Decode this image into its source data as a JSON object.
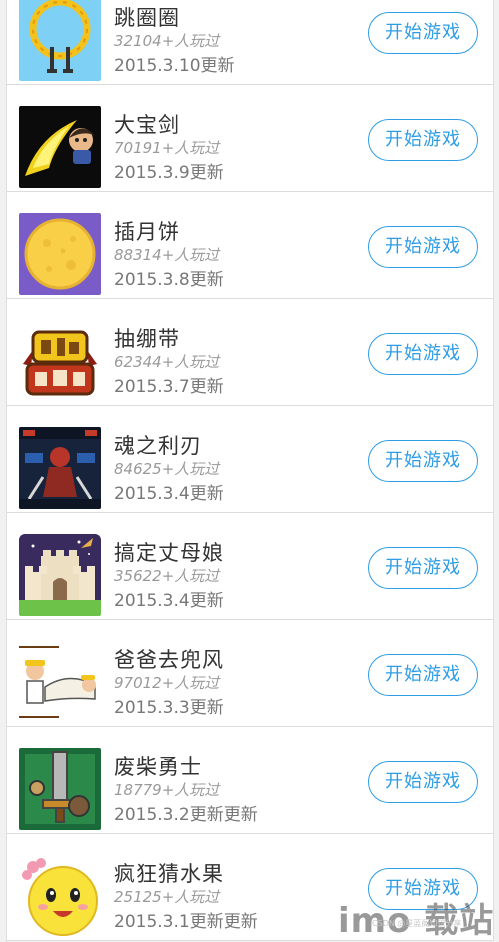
{
  "games": [
    {
      "title": "跳圈圈",
      "players": "32104+人玩过",
      "updated": "2015.3.10更新",
      "button": "开始游戏",
      "icon": "ring-jump-game-icon"
    },
    {
      "title": "大宝剑",
      "players": "70191+人玩过",
      "updated": "2015.3.9更新",
      "button": "开始游戏",
      "icon": "flaming-sword-game-icon"
    },
    {
      "title": "插月饼",
      "players": "88314+人玩过",
      "updated": "2015.3.8更新",
      "button": "开始游戏",
      "icon": "mooncake-game-icon"
    },
    {
      "title": "抽绷带",
      "players": "62344+人玩过",
      "updated": "2015.3.7更新",
      "button": "开始游戏",
      "icon": "monster-fight-logo-icon"
    },
    {
      "title": "魂之利刃",
      "players": "84625+人玩过",
      "updated": "2015.3.4更新",
      "button": "开始游戏",
      "icon": "soul-blade-game-icon"
    },
    {
      "title": "搞定丈母娘",
      "players": "35622+人玩过",
      "updated": "2015.3.4更新",
      "button": "开始游戏",
      "icon": "castle-game-icon"
    },
    {
      "title": "爸爸去兜风",
      "players": "97012+人玩过",
      "updated": "2015.3.3更新",
      "button": "开始游戏",
      "icon": "dad-ride-game-icon"
    },
    {
      "title": "废柴勇士",
      "players": "18779+人玩过",
      "updated": "2015.3.2更新更新",
      "button": "开始游戏",
      "icon": "knight-sword-game-icon"
    },
    {
      "title": "疯狂猜水果",
      "players": "25125+人玩过",
      "updated": "2015.3.1更新更新",
      "button": "开始游戏",
      "icon": "smiley-fruit-game-icon"
    }
  ],
  "watermark": {
    "small": "CSDN @星蓝阁知识分享",
    "big": "imo 载站"
  },
  "colors": {
    "accent": "#2e9de6",
    "title": "#333333",
    "muted": "#9a9a9a"
  }
}
